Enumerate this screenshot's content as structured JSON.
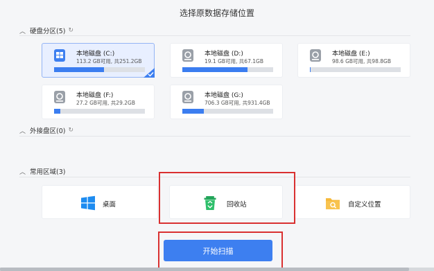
{
  "title": "选择原数据存储位置",
  "sections": {
    "hard_disk": "硬盘分区(5)",
    "external": "外接盘区(0)",
    "common": "常用区域(3)"
  },
  "disks": [
    {
      "name": "本地磁盘 (C:)",
      "meta": "113.2 GB可用, 共251.2GB",
      "used_fraction": 0.55,
      "selected": true
    },
    {
      "name": "本地磁盘 (D:)",
      "meta": "19.1 GB可用, 共67.1GB",
      "used_fraction": 0.72,
      "selected": false
    },
    {
      "name": "本地磁盘 (E:)",
      "meta": "98.6 GB可用, 共98.8GB",
      "used_fraction": 0.002,
      "selected": false
    },
    {
      "name": "本地磁盘 (F:)",
      "meta": "27.2 GB可用, 共29.2GB",
      "used_fraction": 0.07,
      "selected": false
    },
    {
      "name": "本地磁盘 (G:)",
      "meta": "706.3 GB可用, 共931.4GB",
      "used_fraction": 0.24,
      "selected": false
    }
  ],
  "areas": [
    {
      "label": "桌面",
      "icon": "windows-icon"
    },
    {
      "label": "回收站",
      "icon": "recycle-bin-icon"
    },
    {
      "label": "自定义位置",
      "icon": "custom-folder-icon"
    }
  ],
  "scan_button": "开始扫描",
  "colors": {
    "accent": "#3d7ff0",
    "highlight": "#d93030"
  }
}
